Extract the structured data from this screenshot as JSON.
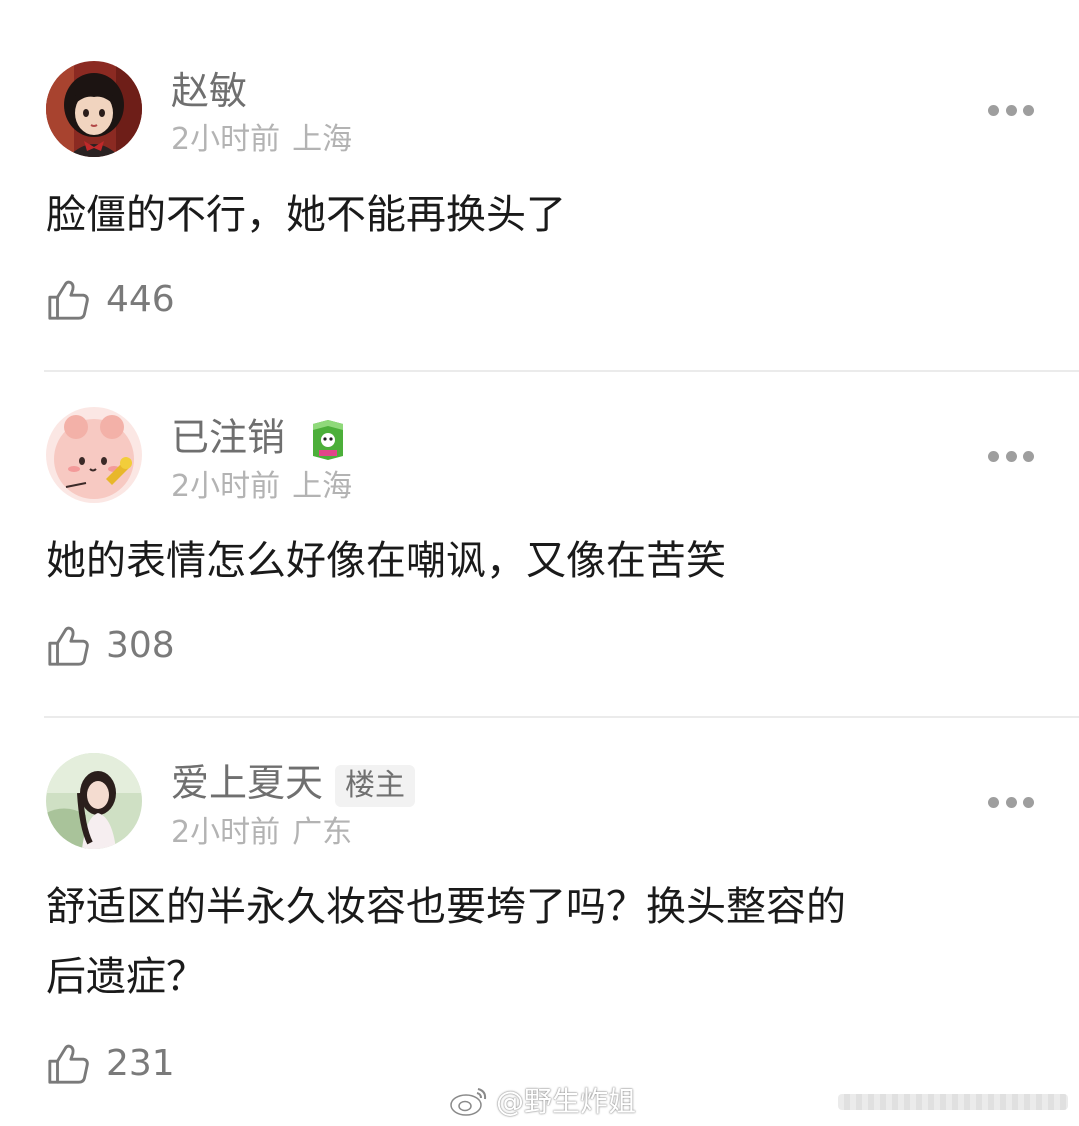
{
  "comments": [
    {
      "username": "赵敏",
      "time": "2小时前",
      "location": "上海",
      "content": "脸僵的不行，她不能再换头了",
      "likes": "446",
      "avatar_icon": "avatar-girl-bob-hair"
    },
    {
      "username": "已注销",
      "time": "2小时前",
      "location": "上海",
      "content": "她的表情怎么好像在嘲讽，又像在苦笑",
      "likes": "308",
      "avatar_icon": "avatar-pink-cartoon",
      "medal_icon": "green-medal-icon"
    },
    {
      "username": "爱上夏天",
      "op_badge": "楼主",
      "time": "2小时前",
      "location": "广东",
      "content_line1": "舒适区的半永久妆容也要垮了吗？换头整容的",
      "content_line2": "后遗症？",
      "likes": "231",
      "avatar_icon": "avatar-girl-photo"
    }
  ],
  "watermark": {
    "text": "@野生炸姐",
    "icon": "weibo-logo-icon"
  },
  "colors": {
    "username": "#6f6f6f",
    "meta": "#b3b3b3",
    "content": "#1a1a1a",
    "divider": "#ebebeb"
  }
}
